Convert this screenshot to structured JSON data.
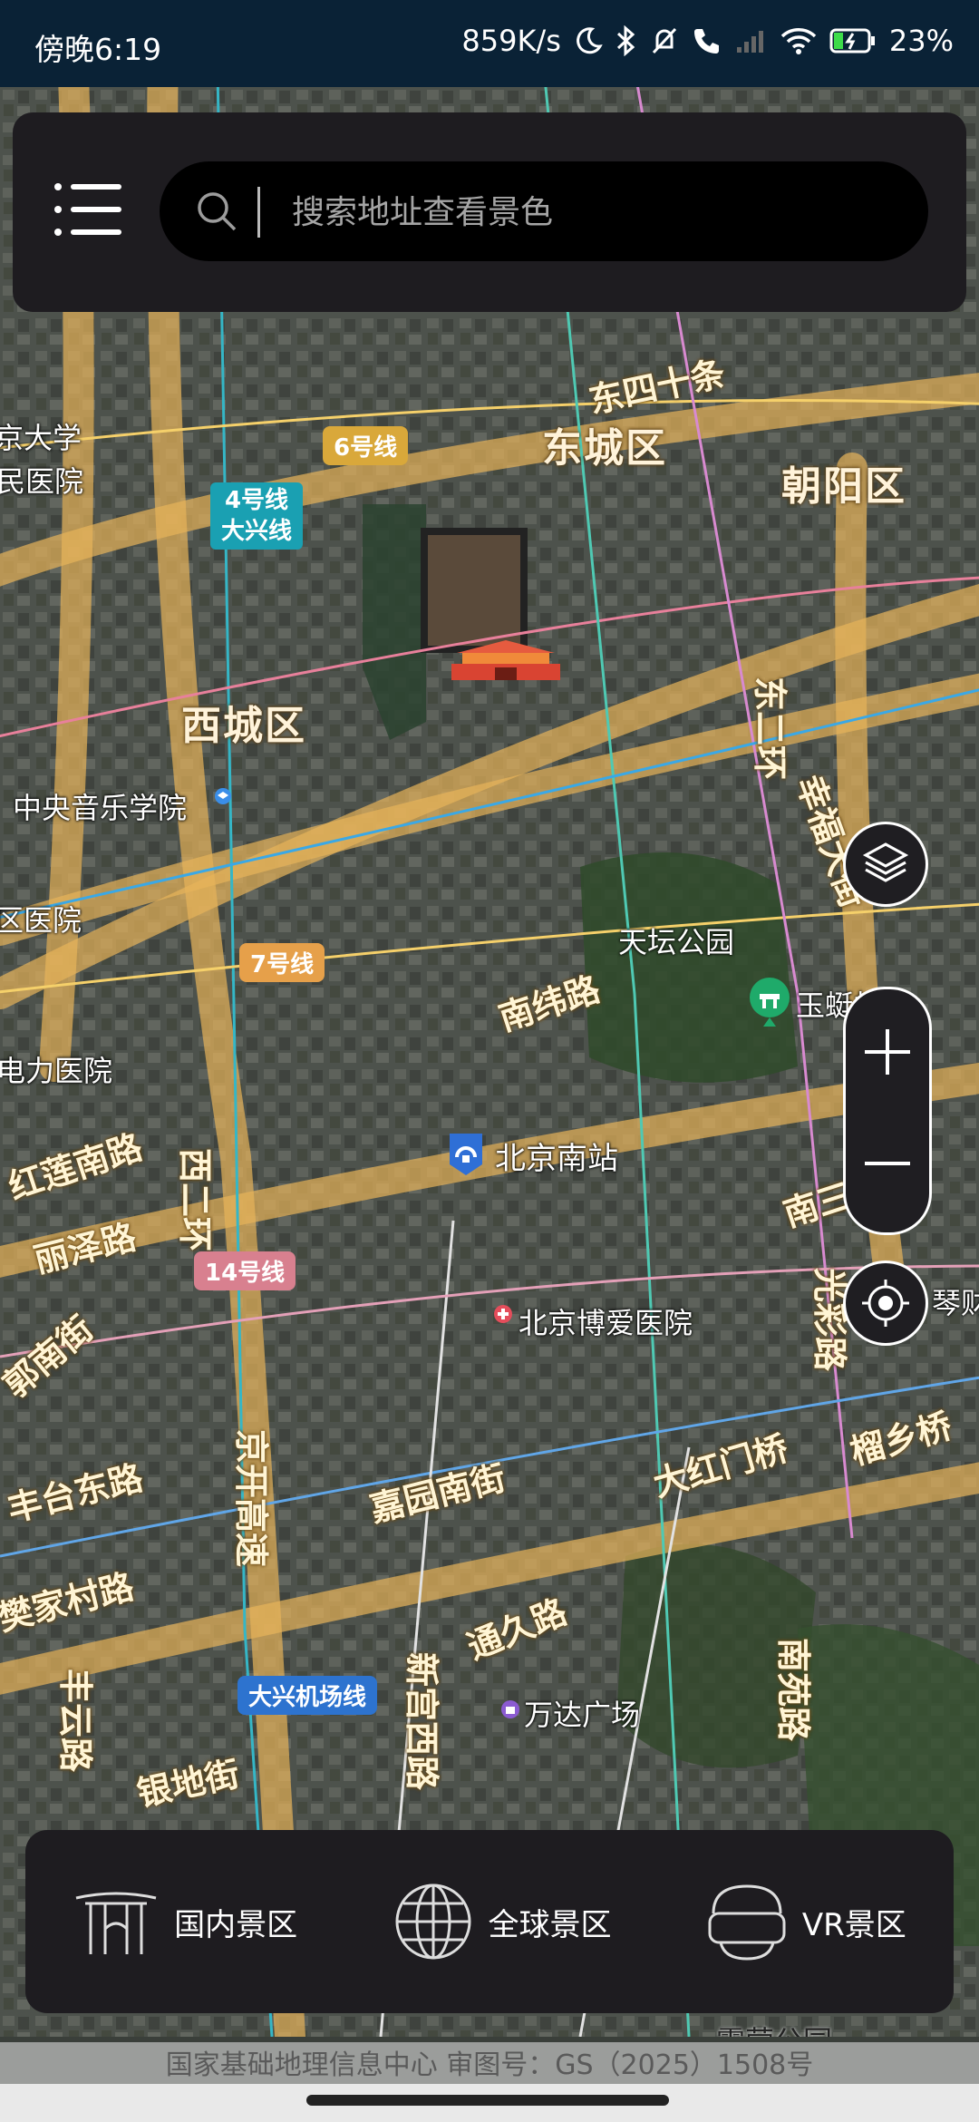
{
  "status_bar": {
    "time": "傍晚6:19",
    "network_speed": "859K/s",
    "battery": "23%"
  },
  "search": {
    "placeholder": "搜索地址查看景色"
  },
  "map": {
    "districts": [
      "东城区",
      "朝阳区",
      "西城区"
    ],
    "roads": [
      "东四十条",
      "东二环",
      "西二环",
      "南纬路",
      "红莲南路",
      "丽泽路",
      "京开高速",
      "嘉园南街",
      "大红门桥",
      "榴乡桥",
      "南三环",
      "光彩路",
      "通久路",
      "新宫西路",
      "南苑路",
      "丰台东路",
      "樊家村路",
      "丰云路",
      "银地街",
      "郭南街",
      "幸福大街"
    ],
    "places": [
      "中央音乐学院",
      "天坛公园",
      "北京南站",
      "北京博爱医院",
      "万达广场",
      "露营公园",
      "京大学",
      "民医院",
      "区医院",
      "电力医院",
      "玉蜓桥",
      "琴财"
    ],
    "metro_lines": [
      "6号线",
      "4号线",
      "大兴线",
      "7号线",
      "14号线",
      "大兴机场线"
    ]
  },
  "bottom_nav": {
    "items": [
      {
        "label": "国内景区",
        "icon": "gate-icon"
      },
      {
        "label": "全球景区",
        "icon": "globe-icon"
      },
      {
        "label": "VR景区",
        "icon": "vr-headset-icon"
      }
    ]
  },
  "credit": "国家基础地理信息中心   审图号：GS（2025）1508号",
  "colors": {
    "card_bg": "#1e1c20",
    "status_bg": "#0a2236",
    "ring_road": "#e7b35a"
  }
}
